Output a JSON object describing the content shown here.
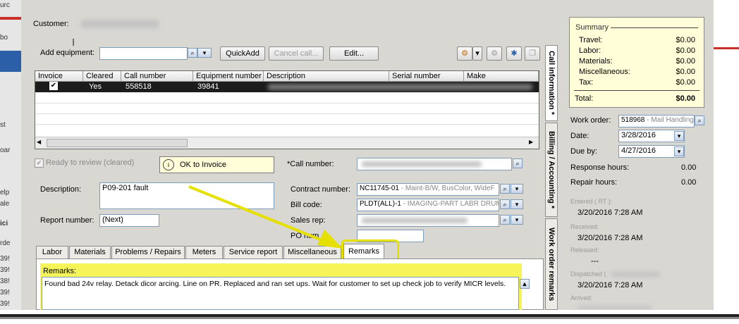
{
  "customer": {
    "label": "Customer:"
  },
  "equipment": {
    "add_label": "Add equipment:",
    "quickadd": "QuickAdd",
    "cancel_call": "Cancel call...",
    "edit": "Edit..."
  },
  "grid": {
    "headers": [
      "Invoice",
      "Cleared",
      "Call number",
      "Equipment number",
      "Description",
      "Serial number",
      "Make"
    ],
    "row": {
      "invoice": "✔",
      "cleared": "Yes",
      "call_number": "558518",
      "equipment_number": "39841"
    }
  },
  "form": {
    "ready_to_review": "Ready to review (cleared)",
    "ok_to_invoice": "OK to Invoice",
    "call_number_label": "*Call number:",
    "description_label": "Description:",
    "description_value": "P09-201 fault",
    "report_number_label": "Report number:",
    "report_number_value": "(Next)",
    "contract_number_label": "Contract number:",
    "contract_number_value": "NC11745-01",
    "contract_number_desc": " - Maint-B/W, BusColor, WideF",
    "bill_code_label": "Bill code:",
    "bill_code_value": "PLDT(ALL)-1",
    "bill_code_desc": " - IMAGING-PART LABR DRUM",
    "sales_rep_label": "Sales rep:",
    "po_number_label": "PO num"
  },
  "tabs": [
    "Labor",
    "Materials",
    "Problems / Repairs",
    "Meters",
    "Service report",
    "Miscellaneous",
    "Remarks"
  ],
  "remarks": {
    "label": "Remarks:",
    "text": "Found bad 24v relay.  Detack dicor arcing.  Line on PR. Replaced and ran set ups. Wait for customer to set up check job to verify MICR levels."
  },
  "side_tabs": [
    "Call information *",
    "Billing / Accounting *",
    "Work order remarks"
  ],
  "summary": {
    "title": "Summary",
    "rows": [
      {
        "label": "Travel:",
        "value": "$0.00"
      },
      {
        "label": "Labor:",
        "value": "$0.00"
      },
      {
        "label": "Materials:",
        "value": "$0.00"
      },
      {
        "label": "Miscellaneous:",
        "value": "$0.00"
      },
      {
        "label": "Tax:",
        "value": "$0.00"
      }
    ],
    "total_label": "Total:",
    "total_value": "$0.00"
  },
  "work_order": {
    "label": "Work order:",
    "value": "518968",
    "desc": " - Mail Handling",
    "date_label": "Date:",
    "date_value": "3/28/2016",
    "due_label": "Due by:",
    "due_value": "4/27/2016",
    "response_label": "Response hours:",
    "response_value": "0.00",
    "repair_label": "Repair hours:",
    "repair_value": "0.00"
  },
  "history": {
    "entered_label": "Entered ( RT ):",
    "entered_value": "3/20/2016 7:28 AM",
    "received_label": "Received:",
    "received_value": "3/20/2016 7:28 AM",
    "released_label": "Released:",
    "released_value": "---",
    "dispatched_label": "Dispatched (",
    "dispatched_value": "3/20/2016 7:28 AM",
    "arrived_label": "Arrived:"
  },
  "left_strip": [
    "urc",
    "bo",
    "st",
    "oar",
    "elp",
    "ale",
    "ici",
    "rde",
    "39!",
    "39!",
    "38!",
    "39!",
    "39!",
    "39!"
  ],
  "colors": {
    "highlight": "#f5f55a",
    "callout": "#e6e000",
    "summary_bg": "#fffed8"
  }
}
